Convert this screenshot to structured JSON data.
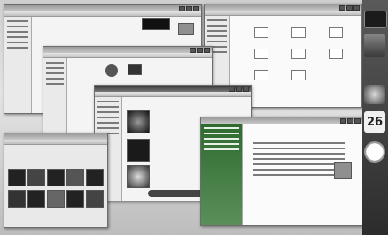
{
  "desktop": {
    "wallpaper_color": "#c9c9c9"
  },
  "sidebar": {
    "calendar_day": "26",
    "gadget_icons": [
      "slideshow-icon",
      "contacts-icon",
      "calendar-icon",
      "clock-icon",
      "weather-icon"
    ]
  },
  "windows": [
    {
      "name": "top-left-explorer",
      "icon": "folder-icon"
    },
    {
      "name": "top-right-explorer",
      "icon": "folder-icon"
    },
    {
      "name": "middle-explorer",
      "icon": "folder-icon"
    },
    {
      "name": "music-player",
      "icon": "music-icon"
    },
    {
      "name": "control-panel",
      "icon": "settings-icon"
    },
    {
      "name": "photo-gallery",
      "icon": "photo-icon"
    }
  ],
  "colors": {
    "accent": "#2f6b2f",
    "titlebar": "#9a9a9a"
  }
}
